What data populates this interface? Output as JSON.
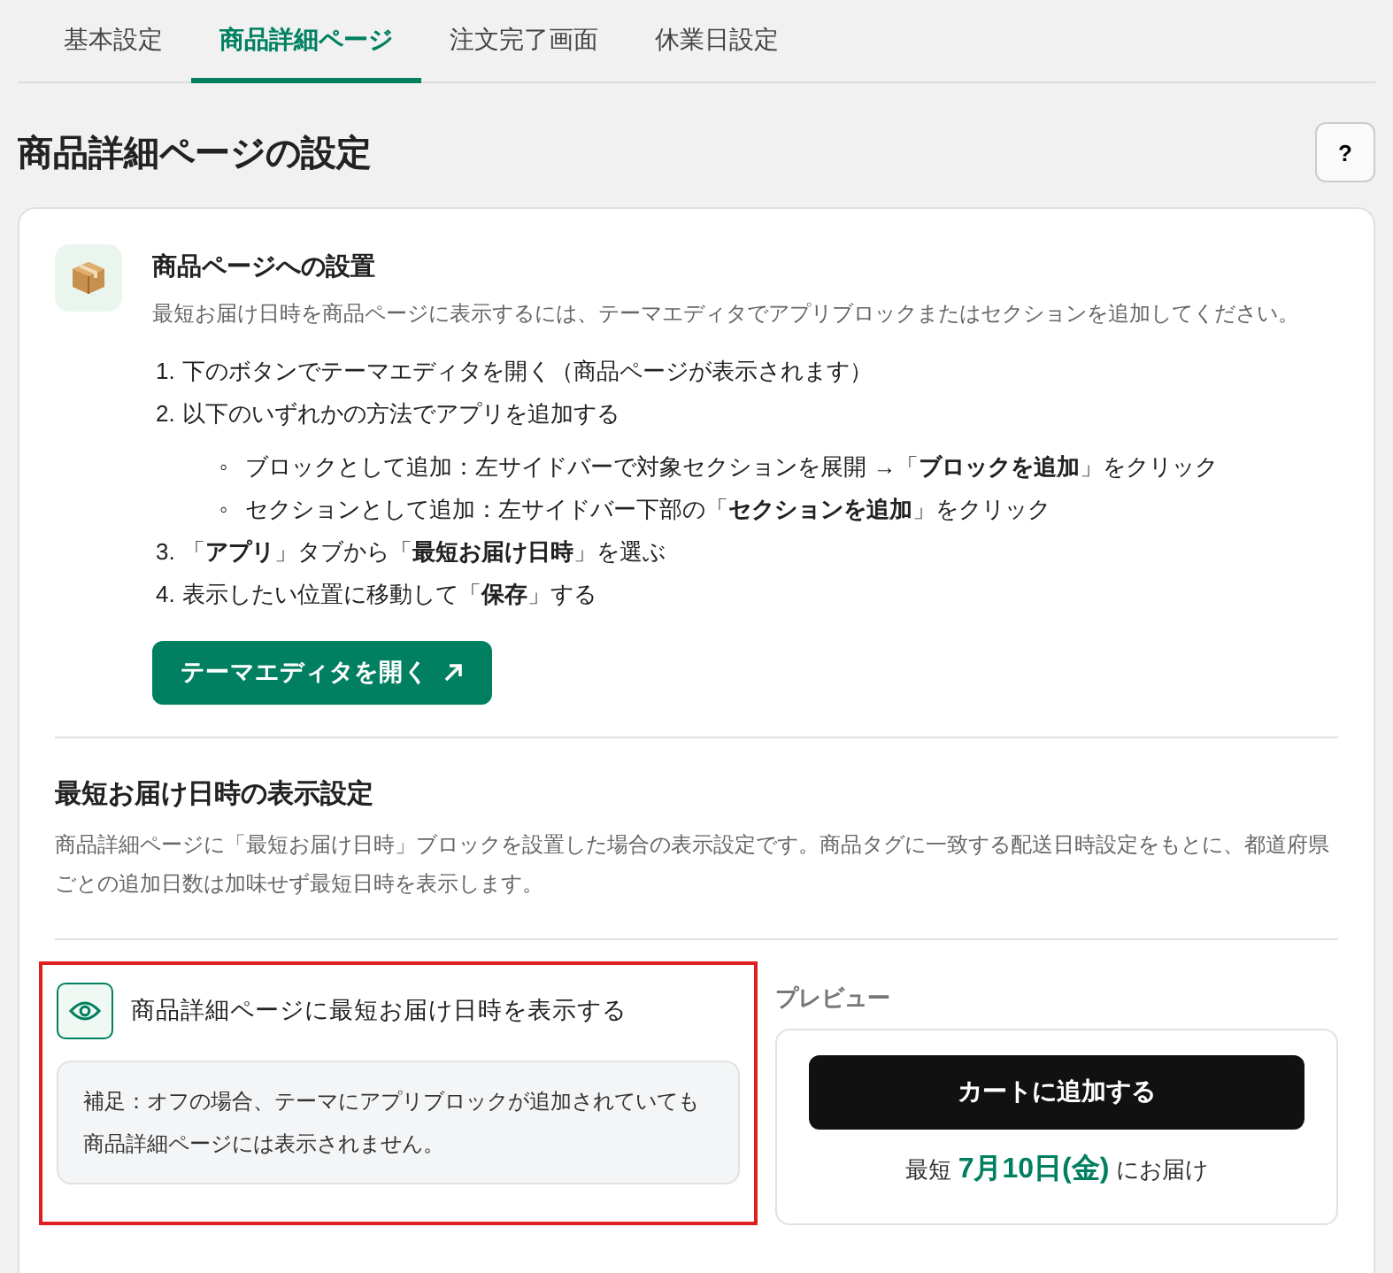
{
  "tabs": [
    {
      "label": "基本設定",
      "selected": false
    },
    {
      "label": "商品詳細ページ",
      "selected": true
    },
    {
      "label": "注文完了画面",
      "selected": false
    },
    {
      "label": "休業日設定",
      "selected": false
    }
  ],
  "page_title": "商品詳細ページの設定",
  "help_button": "?",
  "install": {
    "title": "商品ページへの設置",
    "description": "最短お届け日時を商品ページに表示するには、テーマエディタでアプリブロックまたはセクションを追加してください。",
    "steps": [
      {
        "number": "1.",
        "text": "下のボタンでテーマエディタを開く（商品ページが表示されます）"
      },
      {
        "number": "2.",
        "text": "以下のいずれかの方法でアプリを追加する",
        "children": [
          {
            "bullet": "◦",
            "text": "ブロックとして追加：左サイドバーで対象セクションを展開 →「**ブロックを追加**」をクリック"
          },
          {
            "bullet": "◦",
            "text": "セクションとして追加：左サイドバー下部の「**セクションを追加**」をクリック"
          }
        ]
      },
      {
        "number": "3.",
        "text": "「**アプリ**」タブから「**最短お届け日時**」を選ぶ"
      },
      {
        "number": "4.",
        "text": "表示したい位置に移動して「**保存**」する"
      }
    ],
    "button": "テーマエディタを開く"
  },
  "display": {
    "title": "最短お届け日時の表示設定",
    "description": "商品詳細ページに「最短お届け日時」ブロックを設置した場合の表示設定です。商品タグに一致する配送日時設定をもとに、都道府県ごとの追加日数は加味せず最短日時を表示します。",
    "toggle": {
      "label": "商品詳細ページに最短お届け日時を表示する",
      "on": true
    },
    "note": "補足：オフの場合、テーマにアプリブロックが追加されていても商品詳細ページには表示されません。",
    "preview": {
      "label": "プレビュー",
      "cart_button": "カートに追加する",
      "delivery_prefix": "最短",
      "delivery_date": "7月10日(金)",
      "delivery_suffix": "にお届け"
    }
  }
}
